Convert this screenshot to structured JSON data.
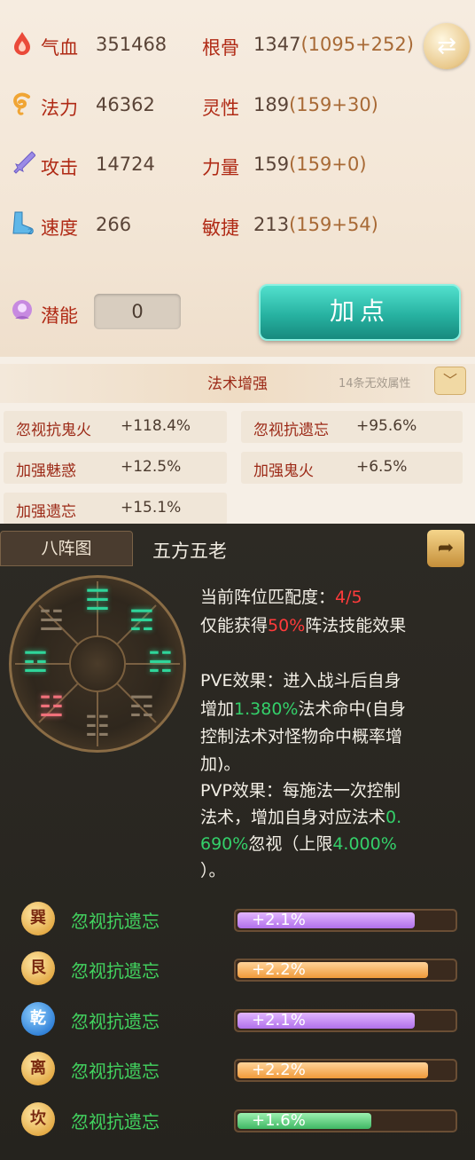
{
  "stats": {
    "hp": {
      "label": "气血",
      "value": "351468",
      "icon": "blood-drop-icon"
    },
    "mp": {
      "label": "法力",
      "value": "46362",
      "icon": "mana-swirl-icon"
    },
    "attack": {
      "label": "攻击",
      "value": "14724",
      "icon": "sword-icon"
    },
    "speed": {
      "label": "速度",
      "value": "266",
      "icon": "boot-icon"
    },
    "constitution": {
      "label": "根骨",
      "value": "1347",
      "detail": "(1095+252)"
    },
    "spirit": {
      "label": "灵性",
      "value": "189",
      "detail": "(159+30)"
    },
    "strength": {
      "label": "力量",
      "value": "159",
      "detail": "(159+0)"
    },
    "agility": {
      "label": "敏捷",
      "value": "213",
      "detail": "(159+54)"
    },
    "potential": {
      "label": "潜能",
      "value": "0"
    },
    "add_point_label": "加点"
  },
  "enhance": {
    "title": "法术增强",
    "invalid_note": "14条无效属性",
    "items": [
      {
        "name": "忽视抗鬼火",
        "value": "+118.4%"
      },
      {
        "name": "忽视抗遗忘",
        "value": "+95.6%"
      },
      {
        "name": "加强魅惑",
        "value": "+12.5%"
      },
      {
        "name": "加强鬼火",
        "value": "+6.5%"
      },
      {
        "name": "加强遗忘",
        "value": "+15.1%"
      }
    ]
  },
  "formation": {
    "tab_label": "八阵图",
    "name": "五方五老",
    "match_label": "当前阵位匹配度：",
    "match_value": "4/5",
    "effect_prefix": "仅能获得",
    "effect_percent": "50%",
    "effect_suffix": "阵法技能效果",
    "pve_line1": "PVE效果：进入战斗后自身",
    "pve_line2_a": "增加",
    "pve_line2_pct": "1.380%",
    "pve_line2_b": "法术命中(自身",
    "pve_line3": "控制法术对怪物命中概率增",
    "pve_line4": "加)。",
    "pvp_line1": "PVP效果：每施法一次控制",
    "pvp_line2_a": "法术，增加自身对应法术",
    "pvp_line2_pct": "0.",
    "pvp_line3_pct": "690%",
    "pvp_line3_b": "忽视（上限",
    "pvp_line3_cap": "4.000%",
    "pvp_line4": "）。",
    "rows": [
      {
        "symbol": "巽",
        "name": "忽视抗遗忘",
        "value": "+2.1%",
        "level": 0.82,
        "color": "purple",
        "badge": "gold"
      },
      {
        "symbol": "艮",
        "name": "忽视抗遗忘",
        "value": "+2.2%",
        "level": 0.88,
        "color": "orange",
        "badge": "gold"
      },
      {
        "symbol": "乾",
        "name": "忽视抗遗忘",
        "value": "+2.1%",
        "level": 0.82,
        "color": "purple",
        "badge": "blue"
      },
      {
        "symbol": "离",
        "name": "忽视抗遗忘",
        "value": "+2.2%",
        "level": 0.88,
        "color": "orange",
        "badge": "gold"
      },
      {
        "symbol": "坎",
        "name": "忽视抗遗忘",
        "value": "+1.6%",
        "level": 0.62,
        "color": "green",
        "badge": "gold"
      }
    ]
  }
}
